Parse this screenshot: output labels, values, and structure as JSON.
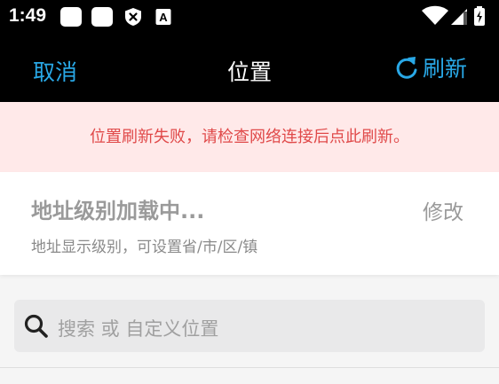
{
  "status_bar": {
    "time": "1:49",
    "icons": [
      "notification-icon",
      "notification-icon",
      "shield-icon",
      "a-icon",
      "wifi-icon",
      "signal-icon",
      "battery-icon"
    ]
  },
  "nav": {
    "cancel_label": "取消",
    "title": "位置",
    "refresh_label": "刷新",
    "accent": "#29a8e6"
  },
  "error": {
    "message": "位置刷新失败，请检查网络连接后点此刷新。",
    "color": "#e04a4a",
    "background": "#ffe9e9"
  },
  "address": {
    "title": "地址级别加载中...",
    "edit_label": "修改",
    "description": "地址显示级别，可设置省/市/区/镇"
  },
  "search": {
    "placeholder": "搜索 或 自定义位置"
  }
}
